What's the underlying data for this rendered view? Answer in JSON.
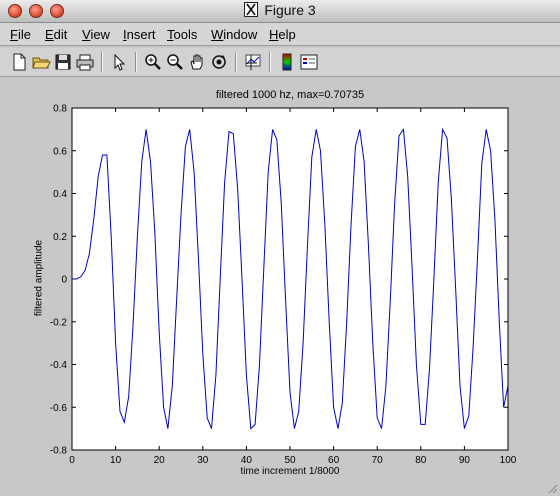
{
  "window": {
    "title": "Figure 3"
  },
  "menu": [
    {
      "label": "File",
      "u": "F",
      "rest": "ile"
    },
    {
      "label": "Edit",
      "u": "E",
      "rest": "dit"
    },
    {
      "label": "View",
      "u": "V",
      "rest": "iew"
    },
    {
      "label": "Insert",
      "u": "I",
      "rest": "nsert"
    },
    {
      "label": "Tools",
      "u": "T",
      "rest": "ools"
    },
    {
      "label": "Window",
      "u": "W",
      "rest": "indow"
    },
    {
      "label": "Help",
      "u": "H",
      "rest": "elp"
    }
  ],
  "toolbar_icons": [
    "new-file-icon",
    "open-folder-icon",
    "save-icon",
    "print-icon",
    "pointer-icon",
    "zoom-in-icon",
    "zoom-out-icon",
    "pan-hand-icon",
    "rotate-3d-icon",
    "data-cursor-icon",
    "colorbar-icon",
    "legend-icon"
  ],
  "chart_data": {
    "type": "line",
    "title": "filtered 1000 hz, max=0.70735",
    "xlabel": "time increment 1/8000",
    "ylabel": "filtered amplitude",
    "xlim": [
      0,
      100
    ],
    "ylim": [
      -0.8,
      0.8
    ],
    "xticks": [
      "0",
      "10",
      "20",
      "30",
      "40",
      "50",
      "60",
      "70",
      "80",
      "90",
      "100"
    ],
    "yticks": [
      "0.8",
      "0.6",
      "0.4",
      "0.2",
      "0",
      "-0.2",
      "-0.4",
      "-0.6",
      "-0.8"
    ],
    "series": [
      {
        "color": "#0000cc",
        "x": [
          0,
          1,
          2,
          3,
          4,
          5,
          6,
          7,
          8,
          9,
          10,
          11,
          12,
          13,
          14,
          15,
          16,
          17,
          18,
          19,
          20,
          21,
          22,
          23,
          24,
          25,
          26,
          27,
          28,
          29,
          30,
          31,
          32,
          33,
          34,
          35,
          36,
          37,
          38,
          39,
          40,
          41,
          42,
          43,
          44,
          45,
          46,
          47,
          48,
          49,
          50,
          51,
          52,
          53,
          54,
          55,
          56,
          57,
          58,
          59,
          60,
          61,
          62,
          63,
          64,
          65,
          66,
          67,
          68,
          69,
          70,
          71,
          72,
          73,
          74,
          75,
          76,
          77,
          78,
          79,
          80,
          81,
          82,
          83,
          84,
          85,
          86,
          87,
          88,
          89,
          90,
          91,
          92,
          93,
          94,
          95,
          96,
          97,
          98,
          99,
          100
        ],
        "y": [
          0,
          0,
          0.01,
          0.04,
          0.12,
          0.28,
          0.48,
          0.58,
          0.58,
          0.2,
          -0.3,
          -0.62,
          -0.67,
          -0.55,
          -0.22,
          0.2,
          0.55,
          0.7,
          0.55,
          0.22,
          -0.25,
          -0.6,
          -0.7,
          -0.5,
          -0.1,
          0.3,
          0.62,
          0.7,
          0.5,
          0.1,
          -0.35,
          -0.65,
          -0.7,
          -0.45,
          0,
          0.45,
          0.69,
          0.68,
          0.42,
          0,
          -0.45,
          -0.7,
          -0.68,
          -0.4,
          0.05,
          0.5,
          0.7,
          0.65,
          0.35,
          -0.1,
          -0.53,
          -0.7,
          -0.62,
          -0.3,
          0.15,
          0.57,
          0.7,
          0.6,
          0.25,
          -0.2,
          -0.6,
          -0.7,
          -0.58,
          -0.2,
          0.25,
          0.62,
          0.7,
          0.55,
          0.15,
          -0.3,
          -0.65,
          -0.7,
          -0.5,
          -0.1,
          0.35,
          0.67,
          0.7,
          0.48,
          0.05,
          -0.4,
          -0.68,
          -0.68,
          -0.42,
          0,
          0.45,
          0.7,
          0.66,
          0.38,
          -0.05,
          -0.5,
          -0.7,
          -0.64,
          -0.32,
          0.1,
          0.54,
          0.7,
          0.6,
          0.28,
          -0.2,
          -0.6,
          -0.5
        ]
      }
    ]
  }
}
